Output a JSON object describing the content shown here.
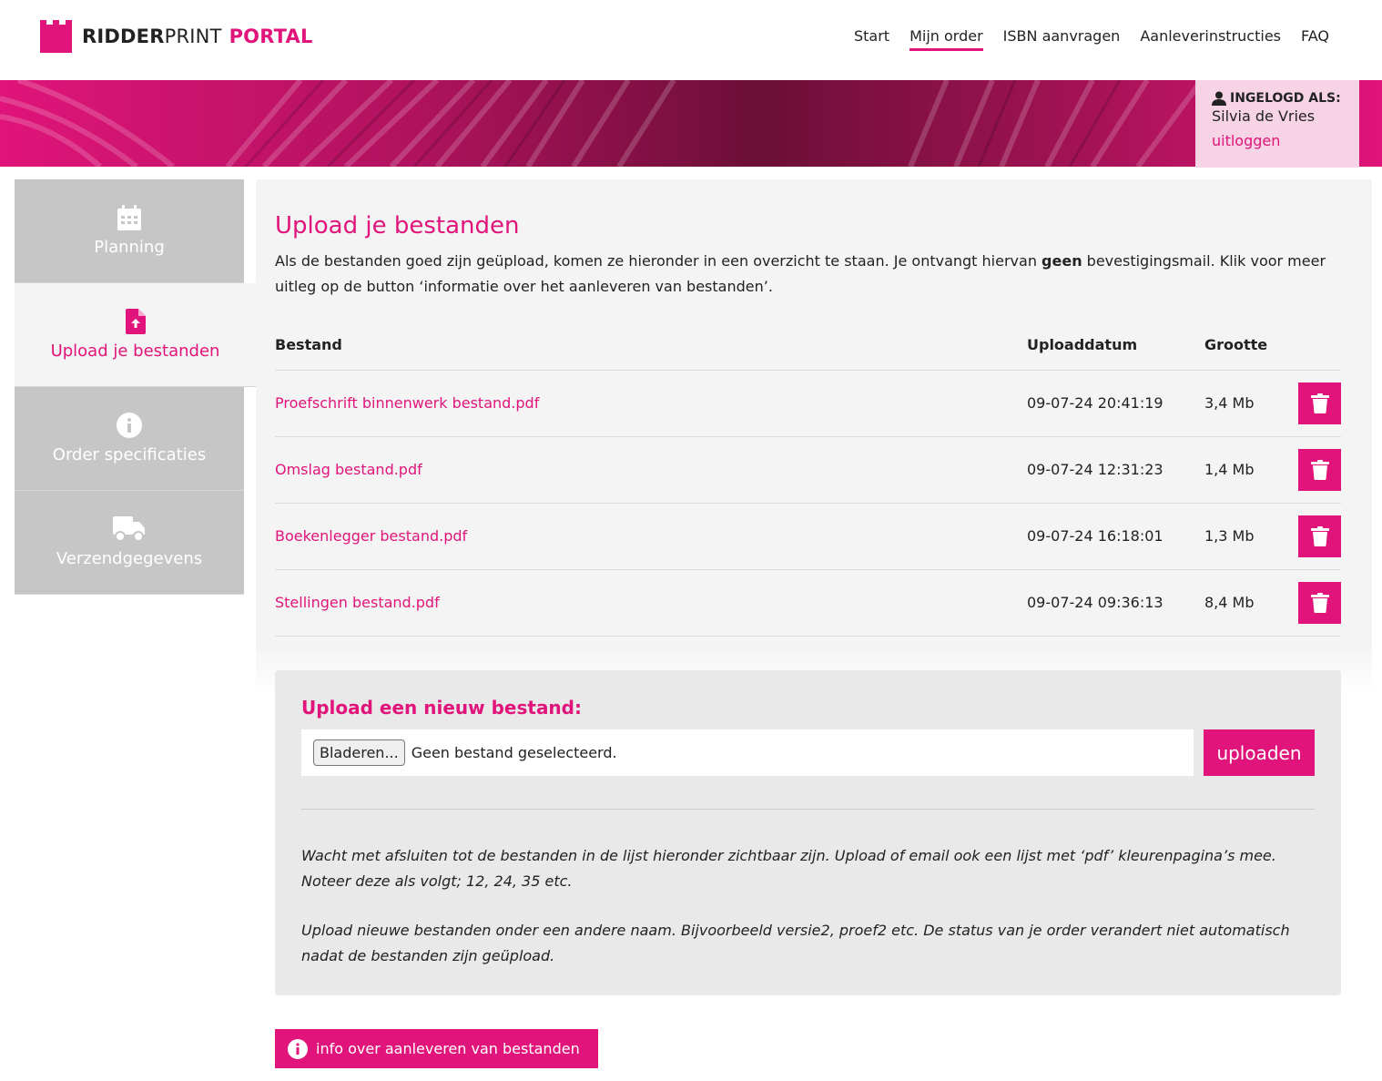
{
  "brand": {
    "bold": "RIDDER",
    "light": "PRINT",
    "portal": "PORTAL",
    "accent": "#e0147a"
  },
  "nav": [
    "Start",
    "Mijn order",
    "ISBN aanvragen",
    "Aanleverinstructies",
    "FAQ"
  ],
  "login": {
    "label": "INGELOGD ALS:",
    "name": "Silvia de Vries",
    "logout": "uitloggen"
  },
  "sidebar": [
    {
      "label": "Planning",
      "icon": "calendar-icon"
    },
    {
      "label": "Upload je bestanden",
      "icon": "file-upload-icon"
    },
    {
      "label": "Order specificaties",
      "icon": "info-icon"
    },
    {
      "label": "Verzendgegevens",
      "icon": "truck-icon"
    }
  ],
  "main": {
    "title": "Upload je bestanden",
    "intro_before": "Als de bestanden goed zijn geüpload, komen ze hieronder in een overzicht te staan. Je ontvangt hiervan ",
    "intro_bold": "geen",
    "intro_after": " bevestigingsmail. Klik voor meer uitleg op de button ‘informatie over het aanleveren van bestanden’."
  },
  "table": {
    "headers": [
      "Bestand",
      "Uploaddatum",
      "Grootte"
    ],
    "rows": [
      {
        "file": "Proefschrift binnenwerk bestand.pdf",
        "date": "09-07-24 20:41:19",
        "size": "3,4 Mb"
      },
      {
        "file": "Omslag bestand.pdf",
        "date": "09-07-24 12:31:23",
        "size": "1,4 Mb"
      },
      {
        "file": "Boekenlegger bestand.pdf",
        "date": "09-07-24 16:18:01",
        "size": "1,3 Mb"
      },
      {
        "file": "Stellingen bestand.pdf",
        "date": "09-07-24 09:36:13",
        "size": "8,4 Mb"
      }
    ]
  },
  "upload": {
    "title": "Upload een nieuw bestand:",
    "browse": "Bladeren...",
    "no_file": "Geen bestand geselecteerd.",
    "button": "uploaden",
    "note1": "Wacht met afsluiten tot de bestanden in de lijst hieronder zichtbaar zijn. Upload of email ook een lijst met ‘pdf’ kleurenpagina’s mee. Noteer deze als volgt; 12, 24, 35 etc.",
    "note2": "Upload nieuwe bestanden onder een andere naam. Bijvoorbeeld versie2, proef2 etc. De status van je order verandert niet automatisch nadat de bestanden zijn geüpload."
  },
  "info_button": "info over aanleveren van bestanden"
}
